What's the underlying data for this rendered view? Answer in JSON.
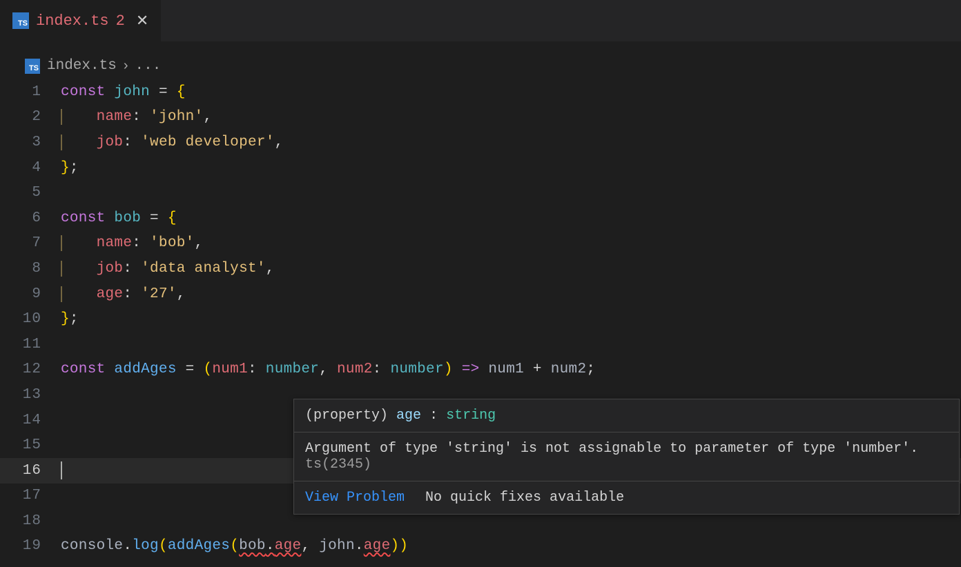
{
  "tab": {
    "filename": "index.ts",
    "modified_badge": "2",
    "icon_label": "TS"
  },
  "breadcrumbs": {
    "filename": "index.ts",
    "chevron": "›",
    "scope": "..."
  },
  "lines": [
    {
      "n": "1",
      "tokens": [
        [
          "kw",
          "const"
        ],
        [
          "sp",
          " "
        ],
        [
          "var",
          "john"
        ],
        [
          "sp",
          " "
        ],
        [
          "op",
          "="
        ],
        [
          "sp",
          " "
        ],
        [
          "br",
          "{"
        ]
      ]
    },
    {
      "n": "2",
      "indent": true,
      "tokens": [
        [
          "pad",
          "    "
        ],
        [
          "prop",
          "name"
        ],
        [
          "punc",
          ":"
        ],
        [
          "sp",
          " "
        ],
        [
          "str",
          "'john'"
        ],
        [
          "punc",
          ","
        ]
      ]
    },
    {
      "n": "3",
      "indent": true,
      "tokens": [
        [
          "pad",
          "    "
        ],
        [
          "prop",
          "job"
        ],
        [
          "punc",
          ":"
        ],
        [
          "sp",
          " "
        ],
        [
          "str",
          "'web developer'"
        ],
        [
          "punc",
          ","
        ]
      ]
    },
    {
      "n": "4",
      "tokens": [
        [
          "br",
          "}"
        ],
        [
          "punc",
          ";"
        ]
      ]
    },
    {
      "n": "5",
      "tokens": []
    },
    {
      "n": "6",
      "tokens": [
        [
          "kw",
          "const"
        ],
        [
          "sp",
          " "
        ],
        [
          "var",
          "bob"
        ],
        [
          "sp",
          " "
        ],
        [
          "op",
          "="
        ],
        [
          "sp",
          " "
        ],
        [
          "br",
          "{"
        ]
      ]
    },
    {
      "n": "7",
      "indent": true,
      "tokens": [
        [
          "pad",
          "    "
        ],
        [
          "prop",
          "name"
        ],
        [
          "punc",
          ":"
        ],
        [
          "sp",
          " "
        ],
        [
          "str",
          "'bob'"
        ],
        [
          "punc",
          ","
        ]
      ]
    },
    {
      "n": "8",
      "indent": true,
      "tokens": [
        [
          "pad",
          "    "
        ],
        [
          "prop",
          "job"
        ],
        [
          "punc",
          ":"
        ],
        [
          "sp",
          " "
        ],
        [
          "str",
          "'data analyst'"
        ],
        [
          "punc",
          ","
        ]
      ]
    },
    {
      "n": "9",
      "indent": true,
      "tokens": [
        [
          "pad",
          "    "
        ],
        [
          "prop",
          "age"
        ],
        [
          "punc",
          ":"
        ],
        [
          "sp",
          " "
        ],
        [
          "str",
          "'27'"
        ],
        [
          "punc",
          ","
        ]
      ]
    },
    {
      "n": "10",
      "tokens": [
        [
          "br",
          "}"
        ],
        [
          "punc",
          ";"
        ]
      ]
    },
    {
      "n": "11",
      "tokens": []
    },
    {
      "n": "12",
      "tokens": [
        [
          "kw",
          "const"
        ],
        [
          "sp",
          " "
        ],
        [
          "func",
          "addAges"
        ],
        [
          "sp",
          " "
        ],
        [
          "op",
          "="
        ],
        [
          "sp",
          " "
        ],
        [
          "br",
          "("
        ],
        [
          "param",
          "num1"
        ],
        [
          "punc",
          ":"
        ],
        [
          "sp",
          " "
        ],
        [
          "type",
          "number"
        ],
        [
          "punc",
          ","
        ],
        [
          "sp",
          " "
        ],
        [
          "param",
          "num2"
        ],
        [
          "punc",
          ":"
        ],
        [
          "sp",
          " "
        ],
        [
          "type",
          "number"
        ],
        [
          "br",
          ")"
        ],
        [
          "sp",
          " "
        ],
        [
          "kw",
          "=>"
        ],
        [
          "sp",
          " "
        ],
        [
          "white",
          "num1"
        ],
        [
          "sp",
          " "
        ],
        [
          "op",
          "+"
        ],
        [
          "sp",
          " "
        ],
        [
          "white",
          "num2"
        ],
        [
          "punc",
          ";"
        ]
      ]
    },
    {
      "n": "13",
      "tokens": []
    },
    {
      "n": "14",
      "tokens": []
    },
    {
      "n": "15",
      "tokens": []
    },
    {
      "n": "16",
      "active": true,
      "tokens": []
    },
    {
      "n": "17",
      "tokens": []
    },
    {
      "n": "18",
      "tokens": []
    },
    {
      "n": "19",
      "tokens": [
        [
          "white",
          "console"
        ],
        [
          "punc",
          "."
        ],
        [
          "func",
          "log"
        ],
        [
          "br",
          "("
        ],
        [
          "func",
          "addAges"
        ],
        [
          "br",
          "("
        ],
        [
          "err",
          "bob.age"
        ],
        [
          "punc",
          ","
        ],
        [
          "sp",
          " "
        ],
        [
          "white",
          "john"
        ],
        [
          "punc",
          "."
        ],
        [
          "err2",
          "age"
        ],
        [
          "br",
          ")"
        ],
        [
          "br",
          ")"
        ]
      ]
    }
  ],
  "hover": {
    "signature": {
      "kw": "(property)",
      "name": "age",
      "colon": ":",
      "type": "string"
    },
    "message": "Argument of type 'string' is not assignable to parameter of type 'number'.",
    "code": "ts(2345)",
    "view_problem": "View Problem",
    "no_fixes": "No quick fixes available"
  }
}
